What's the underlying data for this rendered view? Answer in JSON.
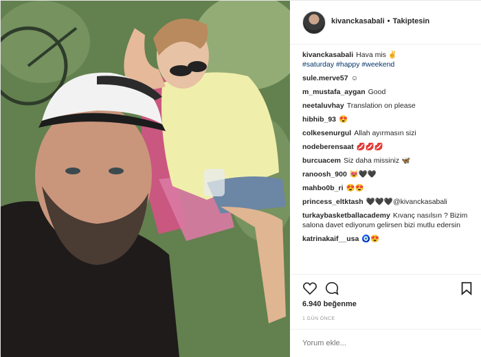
{
  "header": {
    "username": "kivanckasabali",
    "separator": "•",
    "follow_status": "Takiptesin"
  },
  "caption": {
    "username": "kivanckasabali",
    "text": "Hava mis ✌",
    "hashtags": "#saturday #happy #weekend"
  },
  "comments": [
    {
      "user": "sule.merve57",
      "text": "☺"
    },
    {
      "user": "m_mustafa_aygan",
      "text": "Good"
    },
    {
      "user": "neetaluvhay",
      "text": "Translation on please"
    },
    {
      "user": "hibhib_93",
      "text": "😍"
    },
    {
      "user": "colkesenurgul",
      "text": "Allah ayırmasın sizi"
    },
    {
      "user": "nodeberensaat",
      "text": "💋💋💋"
    },
    {
      "user": "burcuacem",
      "text": "Siz daha missiniz 🦋"
    },
    {
      "user": "ranoosh_900",
      "text": "😻🖤🖤"
    },
    {
      "user": "mahbo0b_ri",
      "text": "😍😍"
    },
    {
      "user": "princess_eltktash",
      "text": "🖤🖤🖤@kivanckasabali"
    },
    {
      "user": "turkaybasketballacademy",
      "text": "Kıvanç nasılsın ? Bizim salona davet ediyorum gelirsen bizi mutlu edersin"
    },
    {
      "user": "katrinakaif__usa",
      "text": "🧿😍"
    }
  ],
  "likes": "6.940 beğenme",
  "date": "1 GÜN ÖNCE",
  "comment_input": {
    "placeholder": "Yorum ekle..."
  },
  "icons": [
    "heart-icon",
    "comment-icon",
    "bookmark-icon"
  ]
}
